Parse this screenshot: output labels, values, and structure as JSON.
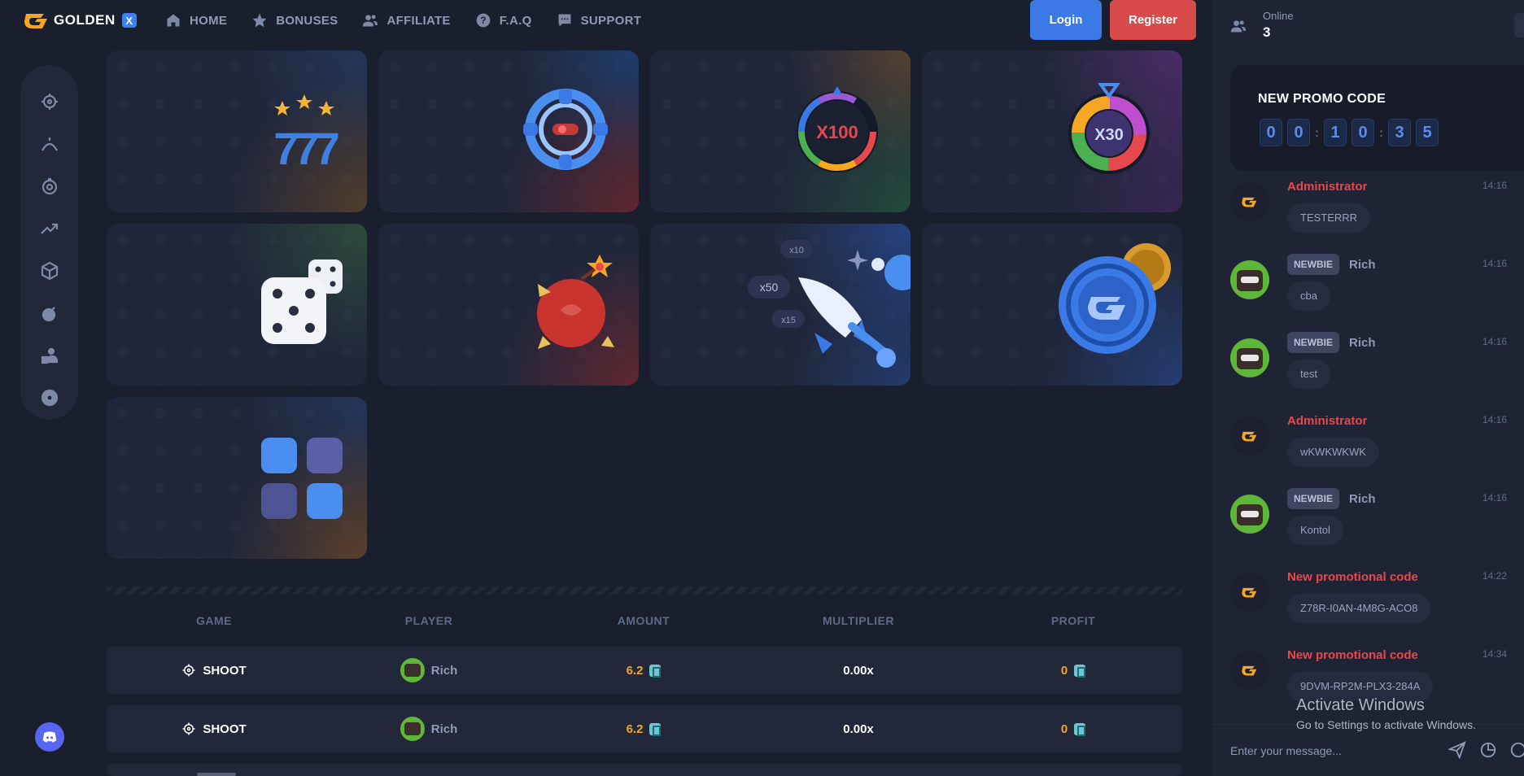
{
  "brand": {
    "name": "GOLDEN",
    "badge": "X"
  },
  "nav": {
    "items": [
      {
        "label": "HOME",
        "icon": "home-icon"
      },
      {
        "label": "BONUSES",
        "icon": "star-icon"
      },
      {
        "label": "AFFILIATE",
        "icon": "users-icon"
      },
      {
        "label": "F.A.Q",
        "icon": "question-icon"
      },
      {
        "label": "SUPPORT",
        "icon": "chat-icon"
      }
    ],
    "login_label": "Login",
    "register_label": "Register"
  },
  "sidebar": {
    "icons": [
      "target-icon",
      "crash-icon",
      "wheel-icon",
      "trend-icon",
      "cube-icon",
      "bomb-icon",
      "user-cards-icon",
      "ball-icon"
    ]
  },
  "games": {
    "tiles": [
      {
        "id": "slots",
        "label": "777"
      },
      {
        "id": "shoot",
        "label": ""
      },
      {
        "id": "wheel-x100",
        "label": "X100"
      },
      {
        "id": "wheel-x30",
        "label": "X30"
      },
      {
        "id": "dice",
        "label": ""
      },
      {
        "id": "mines",
        "label": ""
      },
      {
        "id": "crash",
        "label": "x50",
        "label2": "x10",
        "label3": "x15"
      },
      {
        "id": "coinflip",
        "label": ""
      },
      {
        "id": "keno",
        "label": ""
      }
    ]
  },
  "bets": {
    "columns": [
      "GAME",
      "PLAYER",
      "AMOUNT",
      "MULTIPLIER",
      "PROFIT"
    ],
    "rows": [
      {
        "game": "SHOOT",
        "player": "Rich",
        "amount": "6.2",
        "multiplier": "0.00x",
        "profit": "0"
      },
      {
        "game": "SHOOT",
        "player": "Rich",
        "amount": "6.2",
        "multiplier": "0.00x",
        "profit": "0"
      }
    ]
  },
  "chat": {
    "online_label": "Online",
    "online_count": "3",
    "promo": {
      "title": "NEW PROMO CODE",
      "digits": [
        "0",
        "0",
        "1",
        "0",
        "3",
        "5"
      ]
    },
    "messages": [
      {
        "type": "admin",
        "name": "Administrator",
        "time": "14:16",
        "text": "TESTERRR"
      },
      {
        "type": "newbie",
        "badge": "NEWBIE",
        "name": "Rich",
        "time": "14:16",
        "text": "cba"
      },
      {
        "type": "newbie",
        "badge": "NEWBIE",
        "name": "Rich",
        "time": "14:16",
        "text": "test"
      },
      {
        "type": "admin",
        "name": "Administrator",
        "time": "14:16",
        "text": "wKWKWKWK"
      },
      {
        "type": "newbie",
        "badge": "NEWBIE",
        "name": "Rich",
        "time": "14:16",
        "text": "Kontol"
      },
      {
        "type": "admin",
        "name": "New promotional code",
        "time": "14:22",
        "text": "Z78R-I0AN-4M8G-ACO8"
      },
      {
        "type": "admin",
        "name": "New promotional code",
        "time": "14:34",
        "text": "9DVM-RP2M-PLX3-284A"
      }
    ],
    "input_placeholder": "Enter your message..."
  },
  "os_watermark": {
    "title": "Activate Windows",
    "subtitle": "Go to Settings to activate Windows."
  },
  "colors": {
    "background": "#1a1f2e",
    "accent_blue": "#3b7ae6",
    "accent_red": "#d94a4a",
    "gold": "#f5a623"
  }
}
